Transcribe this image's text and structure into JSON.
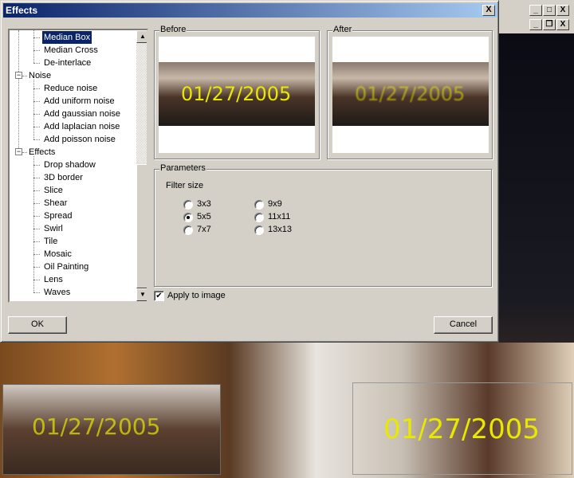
{
  "dialog": {
    "title": "Effects",
    "close": "X"
  },
  "mdi": {
    "minimize": "_",
    "maximize": "□",
    "close": "X",
    "restore": "❐"
  },
  "tree": {
    "items": [
      {
        "label": "Median Box",
        "level": 2,
        "selected": true
      },
      {
        "label": "Median Cross",
        "level": 2
      },
      {
        "label": "De-interlace",
        "level": 2
      },
      {
        "label": "Noise",
        "level": 1,
        "expander": "−"
      },
      {
        "label": "Reduce noise",
        "level": 2
      },
      {
        "label": "Add uniform noise",
        "level": 2
      },
      {
        "label": "Add gaussian noise",
        "level": 2
      },
      {
        "label": "Add laplacian noise",
        "level": 2
      },
      {
        "label": "Add poisson noise",
        "level": 2
      },
      {
        "label": "Effects",
        "level": 1,
        "expander": "−"
      },
      {
        "label": "Drop shadow",
        "level": 2
      },
      {
        "label": "3D border",
        "level": 2
      },
      {
        "label": "Slice",
        "level": 2
      },
      {
        "label": "Shear",
        "level": 2
      },
      {
        "label": "Spread",
        "level": 2
      },
      {
        "label": "Swirl",
        "level": 2
      },
      {
        "label": "Tile",
        "level": 2
      },
      {
        "label": "Mosaic",
        "level": 2
      },
      {
        "label": "Oil Painting",
        "level": 2
      },
      {
        "label": "Lens",
        "level": 2
      },
      {
        "label": "Waves",
        "level": 2
      }
    ],
    "scroll_up": "▲",
    "scroll_down": "▼"
  },
  "before": {
    "label": "Before",
    "date": "01/27/2005"
  },
  "after": {
    "label": "After",
    "date": "01/27/2005"
  },
  "parameters": {
    "label": "Parameters",
    "filter_size_label": "Filter size",
    "options": [
      {
        "label": "3x3"
      },
      {
        "label": "5x5",
        "checked": true
      },
      {
        "label": "7x7"
      },
      {
        "label": "9x9"
      },
      {
        "label": "11x11"
      },
      {
        "label": "13x13"
      }
    ]
  },
  "apply": {
    "label": "Apply to image",
    "checked": true,
    "mark": "✔"
  },
  "buttons": {
    "ok": "OK",
    "cancel": "Cancel"
  },
  "background": {
    "date_left": "01/27/2005",
    "date_right": "01/27/2005"
  },
  "colors": {
    "titlebar": "#0a246a",
    "selection": "#0a246a",
    "date": "#e8e800"
  }
}
